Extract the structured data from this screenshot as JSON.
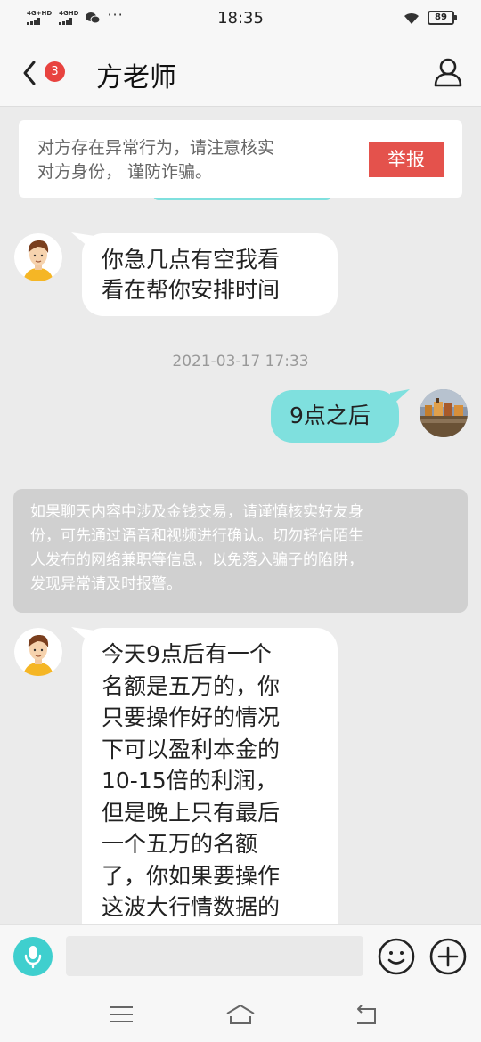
{
  "status_bar": {
    "network1": "4G+HD",
    "network2": "4GHD",
    "more": "···",
    "time": "18:35",
    "battery": "89"
  },
  "nav": {
    "unread_count": "3",
    "title": "方老师"
  },
  "warning": {
    "line1": "对方存在异常行为，请注意核实",
    "line2": "对方身份， 谨防诈骗。",
    "report_label": "举报"
  },
  "messages": [
    {
      "side": "in",
      "lines": [
        "你急几点有空我看",
        "看在帮你安排时间"
      ]
    },
    {
      "side": "out",
      "lines": [
        "9点之后"
      ]
    },
    {
      "side": "in",
      "lines": [
        "今天9点后有一个",
        "名额是五万的，你",
        "只要操作好的情况",
        "下可以盈利本金的",
        "10-15倍的利润，",
        "但是晚上只有最后",
        "一个五万的名额",
        "了，你如果要操作",
        "这波大行情数据的"
      ]
    }
  ],
  "timestamp": "2021-03-17 17:33",
  "notice": {
    "lines": [
      "如果聊天内容中涉及金钱交易，请谨慎核实好友身",
      "份，可先通过语音和视频进行确认。切勿轻信陌生",
      "人发布的网络兼职等信息，以免落入骗子的陷阱，",
      "发现异常请及时报警。"
    ]
  },
  "input": {
    "placeholder": ""
  },
  "colors": {
    "accent": "#3fcfce",
    "outgoing_bubble": "#7fe0de",
    "report_red": "#e4524c",
    "badge_red": "#e8433f"
  },
  "icons": [
    "back-icon",
    "person-icon",
    "mic-icon",
    "smiley-icon",
    "plus-icon",
    "menu-icon",
    "home-icon",
    "back-nav-icon"
  ]
}
